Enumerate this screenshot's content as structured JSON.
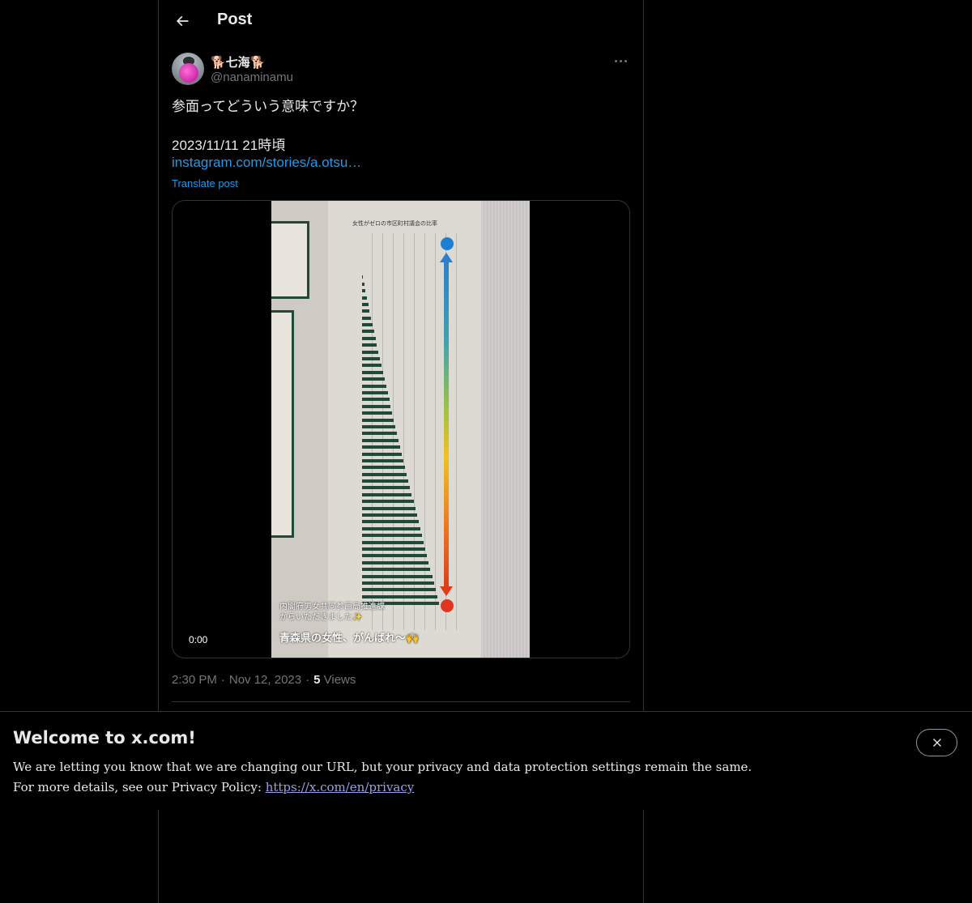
{
  "header": {
    "title": "Post"
  },
  "post": {
    "author": {
      "display_name": "🐕七海🐕",
      "handle": "@nanaminamu"
    },
    "text_line1": "参面ってどういう意味ですか？",
    "text_line2": "2023/11/11 21時頃",
    "link": "instagram.com/stories/a.otsu…",
    "translate_label": "Translate post",
    "media": {
      "chart_title": "女性がゼロの市区町村議会の比率",
      "caption_small_line1": "内閣府男女共同参画局推進課",
      "caption_small_line2": "からいただきました✨",
      "caption_big": "青森県の女性、がんばれ〜🙌",
      "timecode": "0:00"
    },
    "time": "2:30 PM",
    "date": "Nov 12, 2023",
    "views_count": "5",
    "views_label": "Views"
  },
  "banner": {
    "title": "Welcome to x.com!",
    "line1": "We are letting you know that we are changing our URL, but your privacy and data protection settings remain the same.",
    "line2_prefix": "For more details, see our Privacy Policy: ",
    "link": "https://x.com/en/privacy"
  },
  "icons": {
    "back": "back-arrow-icon",
    "more": "more-icon",
    "close": "close-icon"
  },
  "colors": {
    "background": "#000000",
    "text": "#e7e9ea",
    "muted": "#71767b",
    "link": "#1d9bf0",
    "border": "#2f3336"
  }
}
